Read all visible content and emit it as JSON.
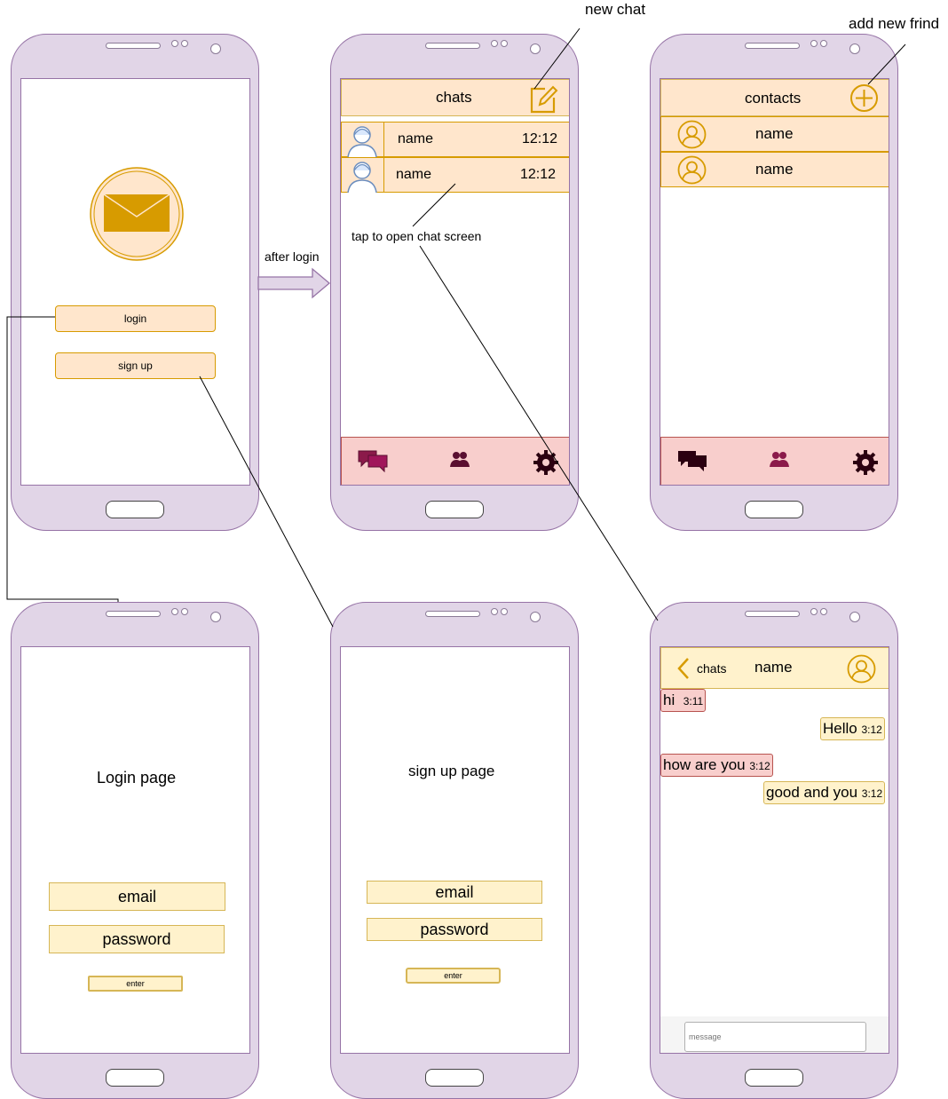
{
  "annotations": {
    "new_chat": "new chat",
    "add_new_friend": "add new frind",
    "after_login": "after login",
    "tap_to_open": "tap to open chat screen"
  },
  "welcome": {
    "login": "login",
    "signup": "sign up"
  },
  "chats_screen": {
    "title": "chats",
    "rows": [
      {
        "name": "name",
        "time": "12:12"
      },
      {
        "name": "name",
        "time": "12:12"
      }
    ]
  },
  "contacts_screen": {
    "title": "contacts",
    "rows": [
      {
        "name": "name"
      },
      {
        "name": "name"
      }
    ]
  },
  "login_page": {
    "title": "Login page",
    "email": "email",
    "password": "password",
    "enter": "enter"
  },
  "signup_page": {
    "title": "sign up page",
    "email": "email",
    "password": "password",
    "enter": "enter"
  },
  "chat_screen": {
    "back": "chats",
    "name": "name",
    "messages": [
      {
        "text": "hi",
        "time": "3:11",
        "side": "left"
      },
      {
        "text": "Hello",
        "time": "3:12",
        "side": "right"
      },
      {
        "text": "how are you",
        "time": "3:12",
        "side": "left"
      },
      {
        "text": "good and you",
        "time": "3:12",
        "side": "right"
      }
    ],
    "placeholder": "message"
  },
  "colors": {
    "phone": "#e1d5e7",
    "accent": "#d79b00",
    "bar": "#ffe6cc",
    "tab": "#f8cecc",
    "field": "#fff2cc"
  }
}
